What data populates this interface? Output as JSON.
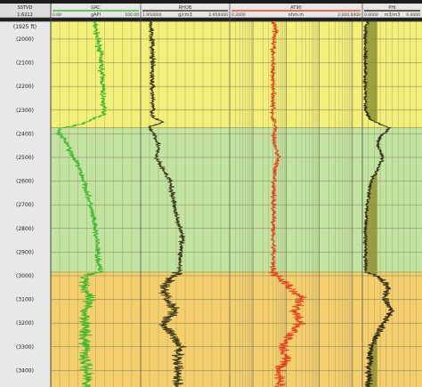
{
  "chart_data": {
    "type": "line",
    "depth_axis": {
      "header": [
        "SSTVD",
        "1:6212"
      ],
      "top_label": "(1925 ft)",
      "range": [
        1925,
        3470
      ],
      "ticks": [
        2000,
        2100,
        2200,
        2300,
        2400,
        2500,
        2600,
        2700,
        2800,
        2900,
        3000,
        3100,
        3200,
        3300,
        3400
      ]
    },
    "zones": [
      {
        "top": 1925,
        "base": 2375,
        "color": "#f3f07a"
      },
      {
        "top": 2375,
        "base": 2985,
        "color": "#c3e4a0"
      },
      {
        "top": 2985,
        "base": 3470,
        "color": "#f4cf6c"
      }
    ],
    "tracks": [
      {
        "name": "GRC",
        "unit": "gAPI",
        "scale_left": "0.00",
        "scale_right": "100.00",
        "xlim": [
          0,
          100
        ],
        "color": "#3dbb2e",
        "noise": 5,
        "profile": [
          [
            1925,
            48
          ],
          [
            1950,
            50
          ],
          [
            2000,
            52
          ],
          [
            2050,
            55
          ],
          [
            2100,
            56
          ],
          [
            2150,
            57
          ],
          [
            2200,
            58
          ],
          [
            2250,
            58
          ],
          [
            2300,
            59
          ],
          [
            2320,
            60
          ],
          [
            2340,
            45
          ],
          [
            2355,
            38
          ],
          [
            2365,
            28
          ],
          [
            2375,
            12
          ],
          [
            2395,
            8
          ],
          [
            2410,
            12
          ],
          [
            2440,
            18
          ],
          [
            2480,
            22
          ],
          [
            2530,
            30
          ],
          [
            2580,
            35
          ],
          [
            2640,
            40
          ],
          [
            2700,
            44
          ],
          [
            2760,
            47
          ],
          [
            2820,
            50
          ],
          [
            2880,
            52
          ],
          [
            2940,
            53
          ],
          [
            2985,
            55
          ],
          [
            3000,
            40
          ],
          [
            3050,
            38
          ],
          [
            3100,
            42
          ],
          [
            3150,
            38
          ],
          [
            3200,
            40
          ],
          [
            3250,
            36
          ],
          [
            3300,
            40
          ],
          [
            3350,
            38
          ],
          [
            3400,
            40
          ],
          [
            3470,
            42
          ]
        ]
      },
      {
        "name": "RHOB",
        "unit": "g/cm3",
        "scale_left": "1.950000",
        "scale_right": "2.950000",
        "xlim": [
          1.95,
          2.95
        ],
        "color": "#3d3a1c",
        "noise": 0.045,
        "profile": [
          [
            1925,
            2.05
          ],
          [
            1950,
            2.07
          ],
          [
            2000,
            2.08
          ],
          [
            2050,
            2.08
          ],
          [
            2100,
            2.08
          ],
          [
            2200,
            2.08
          ],
          [
            2300,
            2.09
          ],
          [
            2330,
            2.08
          ],
          [
            2350,
            2.2
          ],
          [
            2370,
            2.05
          ],
          [
            2390,
            2.08
          ],
          [
            2410,
            2.12
          ],
          [
            2450,
            2.15
          ],
          [
            2500,
            2.12
          ],
          [
            2550,
            2.2
          ],
          [
            2600,
            2.28
          ],
          [
            2650,
            2.3
          ],
          [
            2700,
            2.33
          ],
          [
            2750,
            2.35
          ],
          [
            2800,
            2.4
          ],
          [
            2850,
            2.42
          ],
          [
            2900,
            2.4
          ],
          [
            2985,
            2.38
          ],
          [
            3000,
            2.3
          ],
          [
            3050,
            2.2
          ],
          [
            3100,
            2.25
          ],
          [
            3150,
            2.35
          ],
          [
            3200,
            2.2
          ],
          [
            3250,
            2.3
          ],
          [
            3300,
            2.4
          ],
          [
            3350,
            2.35
          ],
          [
            3400,
            2.38
          ],
          [
            3470,
            2.35
          ]
        ]
      },
      {
        "name": "AT90",
        "unit": "ohm.m",
        "scale_left": "0.2000",
        "scale_right": "2,000.0000",
        "xlim": [
          0.2,
          2000
        ],
        "log_scale": true,
        "color": "#e8431a",
        "noise": 0.12,
        "profile": [
          [
            1925,
            4
          ],
          [
            1950,
            5
          ],
          [
            2000,
            4.5
          ],
          [
            2050,
            4
          ],
          [
            2100,
            4
          ],
          [
            2200,
            4.2
          ],
          [
            2300,
            4
          ],
          [
            2330,
            3.8
          ],
          [
            2350,
            4.5
          ],
          [
            2380,
            5
          ],
          [
            2400,
            4.2
          ],
          [
            2450,
            4.5
          ],
          [
            2500,
            6
          ],
          [
            2550,
            4.5
          ],
          [
            2600,
            4.2
          ],
          [
            2700,
            4.2
          ],
          [
            2800,
            4.2
          ],
          [
            2900,
            4.2
          ],
          [
            2985,
            4.2
          ],
          [
            3000,
            5
          ],
          [
            3050,
            12
          ],
          [
            3100,
            30
          ],
          [
            3150,
            18
          ],
          [
            3200,
            25
          ],
          [
            3250,
            12
          ],
          [
            3300,
            8
          ],
          [
            3350,
            10
          ],
          [
            3400,
            6
          ],
          [
            3470,
            7
          ]
        ]
      },
      {
        "name": "PHI",
        "unit": "m3/m3",
        "scale_left": "0.0000",
        "scale_right": "0.4000",
        "xlim": [
          0.4,
          0
        ],
        "color": "#2f2a12",
        "noise": 0.018,
        "fill": "#8f9033",
        "profile": [
          [
            1925,
            0.36
          ],
          [
            1950,
            0.38
          ],
          [
            2000,
            0.38
          ],
          [
            2100,
            0.38
          ],
          [
            2200,
            0.38
          ],
          [
            2300,
            0.38
          ],
          [
            2340,
            0.35
          ],
          [
            2360,
            0.28
          ],
          [
            2375,
            0.22
          ],
          [
            2395,
            0.24
          ],
          [
            2410,
            0.28
          ],
          [
            2450,
            0.3
          ],
          [
            2500,
            0.26
          ],
          [
            2550,
            0.3
          ],
          [
            2600,
            0.34
          ],
          [
            2700,
            0.37
          ],
          [
            2800,
            0.38
          ],
          [
            2900,
            0.38
          ],
          [
            2985,
            0.38
          ],
          [
            3000,
            0.3
          ],
          [
            3050,
            0.22
          ],
          [
            3100,
            0.25
          ],
          [
            3150,
            0.2
          ],
          [
            3200,
            0.26
          ],
          [
            3250,
            0.3
          ],
          [
            3300,
            0.34
          ],
          [
            3350,
            0.35
          ],
          [
            3400,
            0.36
          ],
          [
            3470,
            0.36
          ]
        ]
      }
    ]
  }
}
